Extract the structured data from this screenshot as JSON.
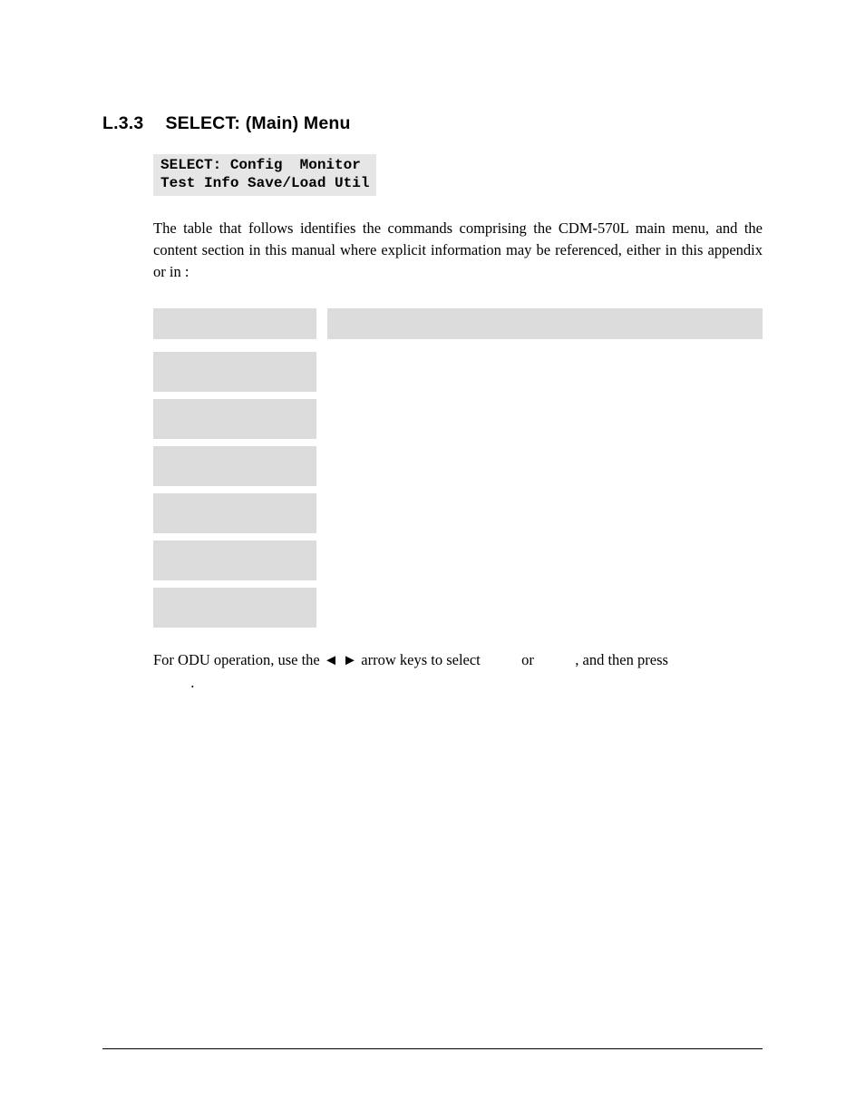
{
  "heading": {
    "number": "L.3.3",
    "title": "SELECT: (Main) Menu"
  },
  "code": {
    "line1": "SELECT: Config  Monitor",
    "line2": "Test Info Save/Load Util"
  },
  "para1": {
    "seg1": "The table that follows identifies the commands comprising the CDM-570L main menu, and the content section in this manual where explicit information may be referenced, either in this appendix or in ",
    "seg2": ":"
  },
  "para2": {
    "seg1": "For ODU operation, use the ",
    "arrows": "◄ ►",
    "seg2": " arrow keys to select ",
    "seg3": " or ",
    "seg4": ", and then press ",
    "seg5": "."
  }
}
